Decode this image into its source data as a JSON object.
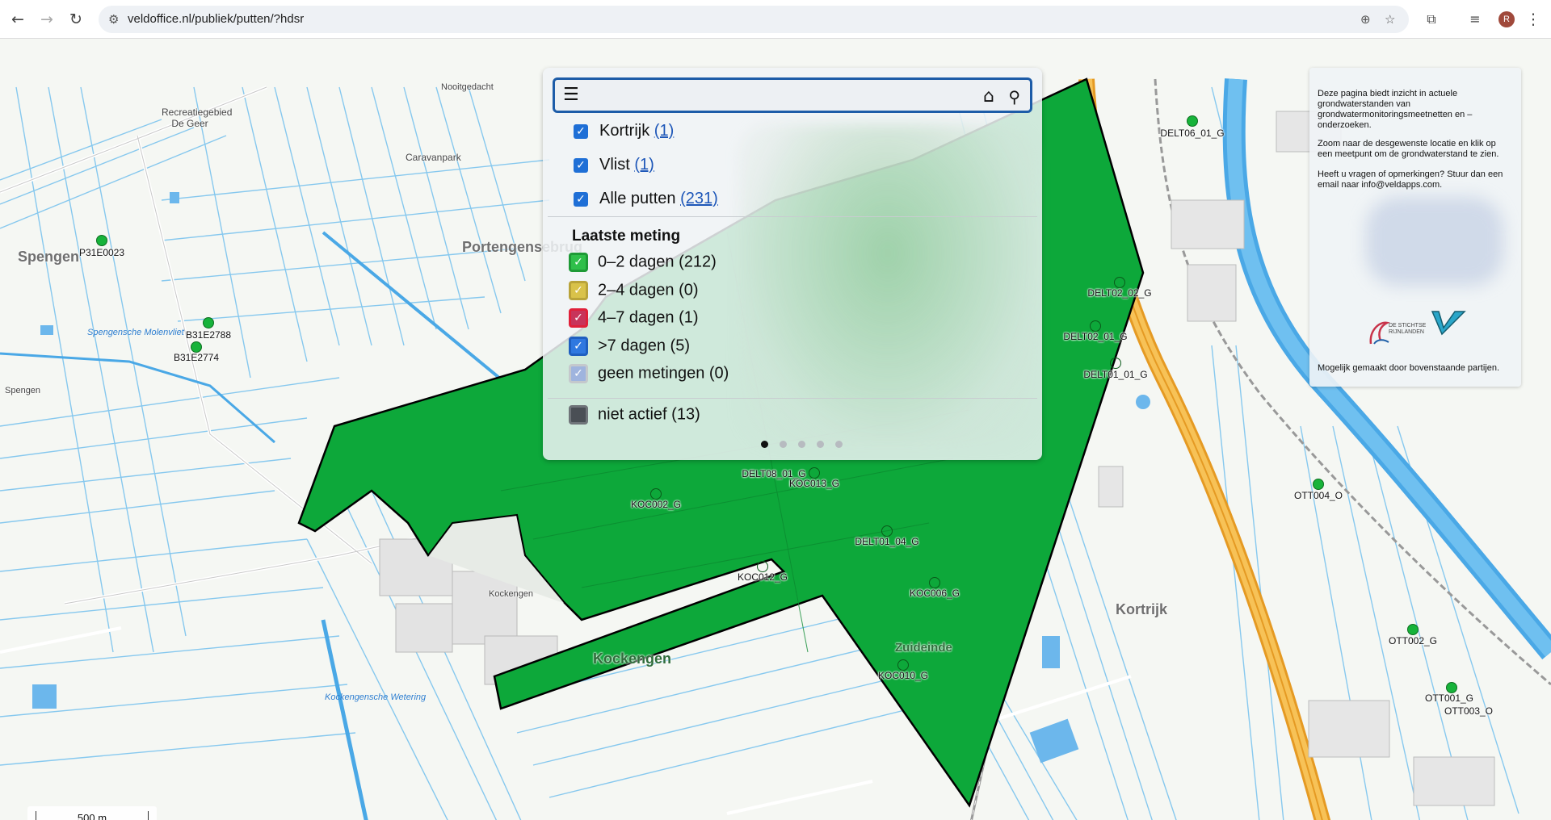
{
  "browser": {
    "url": "veldoffice.nl/publiek/putten/?hdsr",
    "profile_initial": "R",
    "icons": [
      "back-icon",
      "forward-icon",
      "reload-icon",
      "site-info-icon",
      "zoom-icon",
      "star-icon",
      "extensions-icon",
      "media-icon",
      "profile-icon",
      "menu-icon"
    ]
  },
  "panel": {
    "layers": [
      {
        "label": "Kortrijk",
        "count": "(1)",
        "checked": true
      },
      {
        "label": "Vlist",
        "count": "(1)",
        "checked": true
      },
      {
        "label": "Alle putten",
        "count": "(231)",
        "checked": true
      }
    ],
    "legend_title": "Laatste meting",
    "legend": [
      {
        "label": "0–2 dagen (212)",
        "fill": "#2fbf4a",
        "border": "#1e9a36",
        "checked": true
      },
      {
        "label": "2–4 dagen (0)",
        "fill": "#d9c24a",
        "border": "#b9a33a",
        "checked": true
      },
      {
        "label": "4–7 dagen (1)",
        "fill": "#c8345a",
        "border": "#e0203a",
        "checked": true
      },
      {
        "label": ">7 dagen (5)",
        "fill": "#2f78e0",
        "border": "#1f5fc0",
        "checked": true
      },
      {
        "label": "geen metingen (0)",
        "fill": "#9fb4de",
        "border": "#c4c8cc",
        "checked": true
      },
      {
        "label": "niet actief (13)",
        "fill": "#4a4f55",
        "border": "#6f7479",
        "checked": false
      }
    ],
    "pager": {
      "pages": 5,
      "active": 1
    }
  },
  "info": {
    "text1": "Deze pagina biedt inzicht in actuele grondwaterstanden van grondwatermonitoringsmeetnetten en –onderzoeken.",
    "text2": "Zoom naar de desgewenste locatie en klik op een meetpunt om de grondwaterstand te zien.",
    "text3": "Heeft u vragen of opmerkingen? Stuur dan een email naar info@veldapps.com.",
    "text4": "Mogelijk gemaakt door bovenstaande partijen.",
    "logo_text": "DE STICHTSE RIJNLANDEN"
  },
  "map": {
    "colors": {
      "area": "#0da83a",
      "water": "#4aa8e6",
      "highway": "#f2a93b"
    },
    "places": [
      {
        "name": "Spengen",
        "cls": "big"
      },
      {
        "name": "Portengensebrug",
        "cls": "big"
      },
      {
        "name": "Kockengen",
        "cls": "big"
      },
      {
        "name": "Kortrijk",
        "cls": "big"
      },
      {
        "name": "Zuideinde",
        "cls": "big"
      },
      {
        "name": "Recreatiegebied De Geer",
        "cls": "small"
      },
      {
        "name": "Caravanpark",
        "cls": "small"
      },
      {
        "name": "Spengen",
        "cls": "small"
      },
      {
        "name": "Kockengen",
        "cls": "small"
      },
      {
        "name": "Nooitgedacht",
        "cls": "small"
      }
    ],
    "water_names": [
      "Spengensche Molenvliet",
      "Kockengensche Wetering"
    ],
    "wells": [
      {
        "id": "P31E0023"
      },
      {
        "id": "B31E2788"
      },
      {
        "id": "B31E2774"
      },
      {
        "id": "DELT06_01_G"
      },
      {
        "id": "DELT02_02_G"
      },
      {
        "id": "DELT02_01_G"
      },
      {
        "id": "DELT01_01_G"
      },
      {
        "id": "DELT08_01_G"
      },
      {
        "id": "KOC013_G"
      },
      {
        "id": "KOC002_G"
      },
      {
        "id": "DELT01_04_G"
      },
      {
        "id": "KOC012_G"
      },
      {
        "id": "KOC006_G"
      },
      {
        "id": "KOC010_G"
      },
      {
        "id": "OTT004_O"
      },
      {
        "id": "OTT002_G"
      },
      {
        "id": "OTT001_G"
      },
      {
        "id": "OTT003_O"
      }
    ],
    "scale_label": "500 m"
  }
}
